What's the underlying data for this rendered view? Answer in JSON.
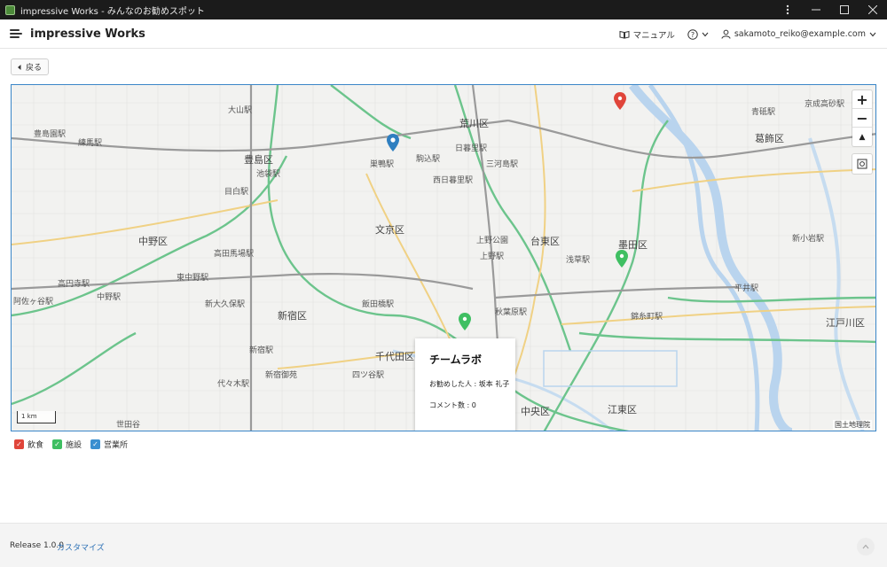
{
  "window": {
    "title": "impressive Works - みんなのお勧めスポット"
  },
  "header": {
    "brand": "impressive Works",
    "manual_label": "マニュアル",
    "user_email": "sakamoto_reiko@example.com"
  },
  "back_button": {
    "label": "戻る"
  },
  "map": {
    "labels": [
      "豊島区",
      "荒川区",
      "葛飾区",
      "文京区",
      "台東区",
      "中野区",
      "新宿区",
      "墨田区",
      "千代田区",
      "江東区",
      "江戸川区",
      "中央区",
      "池袋駅",
      "豊島園駅",
      "練馬駅",
      "大山駅",
      "青砥駅",
      "京成高砂駅",
      "新小岩駅",
      "平井駅",
      "錦糸町駅",
      "浅草駅",
      "上野駅",
      "上野公園",
      "日暮里駅",
      "巣鴨駅",
      "駒込駅",
      "高田馬場駅",
      "中野駅",
      "高円寺駅",
      "阿佐ヶ谷駅",
      "新宿駅",
      "代々木駅",
      "飯田橋駅",
      "四ツ谷駅",
      "秋葉原駅",
      "新宿御苑",
      "世田谷",
      "西日暮里駅",
      "三河島駅",
      "目白駅",
      "東中野駅",
      "新大久保駅"
    ],
    "scale_label": "1 km",
    "attribution": "国土地理院",
    "zoom_in": "+",
    "zoom_out": "−",
    "north": "▲"
  },
  "popup": {
    "title": "チームラボ",
    "recommender_line": "お勧めした人 : 坂本 礼子",
    "comment_line": "コメント数 : 0"
  },
  "legend": [
    {
      "label": "飲食",
      "color": "#e0453a"
    },
    {
      "label": "施設",
      "color": "#3fbf62"
    },
    {
      "label": "営業所",
      "color": "#3a8fd0"
    }
  ],
  "footer": {
    "release": "Release 1.0.0",
    "customize": "カスタマイズ"
  }
}
